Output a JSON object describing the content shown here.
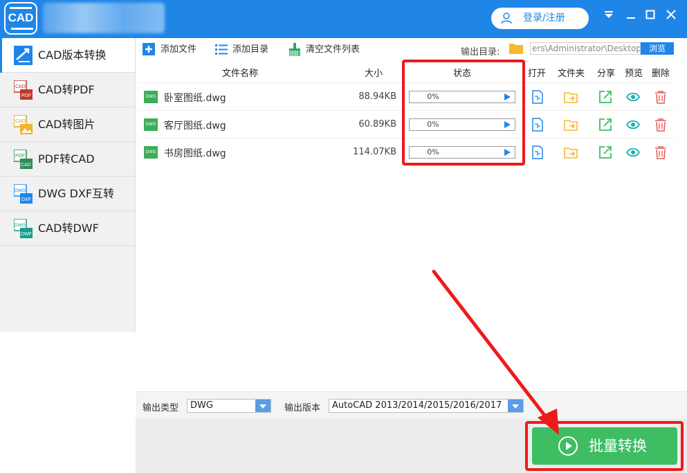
{
  "titlebar": {
    "logo_text": "CAD",
    "login_label": "登录/注册"
  },
  "sidebar": {
    "items": [
      {
        "label": "CAD版本转换",
        "icon": "version-convert-icon"
      },
      {
        "label": "CAD转PDF",
        "icon": "cad-to-pdf-icon"
      },
      {
        "label": "CAD转图片",
        "icon": "cad-to-image-icon"
      },
      {
        "label": "PDF转CAD",
        "icon": "pdf-to-cad-icon"
      },
      {
        "label": "DWG DXF互转",
        "icon": "dwg-dxf-icon"
      },
      {
        "label": "CAD转DWF",
        "icon": "cad-to-dwf-icon"
      }
    ]
  },
  "toolbar": {
    "add_file": "添加文件",
    "add_dir": "添加目录",
    "clear_list": "清空文件列表",
    "output_dir_label": "输出目录:",
    "output_dir_value": "ers\\Administrator\\Desktop",
    "browse": "浏览"
  },
  "table": {
    "headers": {
      "name": "文件名称",
      "size": "大小",
      "status": "状态",
      "open": "打开",
      "folder": "文件夹",
      "share": "分享",
      "preview": "预览",
      "delete": "删除"
    },
    "rows": [
      {
        "icon_text": "DWG",
        "name": "卧室图纸.dwg",
        "size": "88.94KB",
        "progress_text": "0%",
        "progress": 0
      },
      {
        "icon_text": "DWG",
        "name": "客厅图纸.dwg",
        "size": "60.89KB",
        "progress_text": "0%",
        "progress": 0
      },
      {
        "icon_text": "DWG",
        "name": "书房图纸.dwg",
        "size": "114.07KB",
        "progress_text": "0%",
        "progress": 0
      }
    ]
  },
  "bottom": {
    "output_type_label": "输出类型",
    "output_type_value": "DWG",
    "output_version_label": "输出版本",
    "output_version_value": "AutoCAD 2013/2014/2015/2016/2017",
    "convert_label": "批量转换"
  },
  "colors": {
    "primary": "#1f86e8",
    "success": "#3ebd63",
    "highlight": "#ee1a1a",
    "warning_folder": "#f5b82e",
    "danger": "#e85c5c"
  }
}
